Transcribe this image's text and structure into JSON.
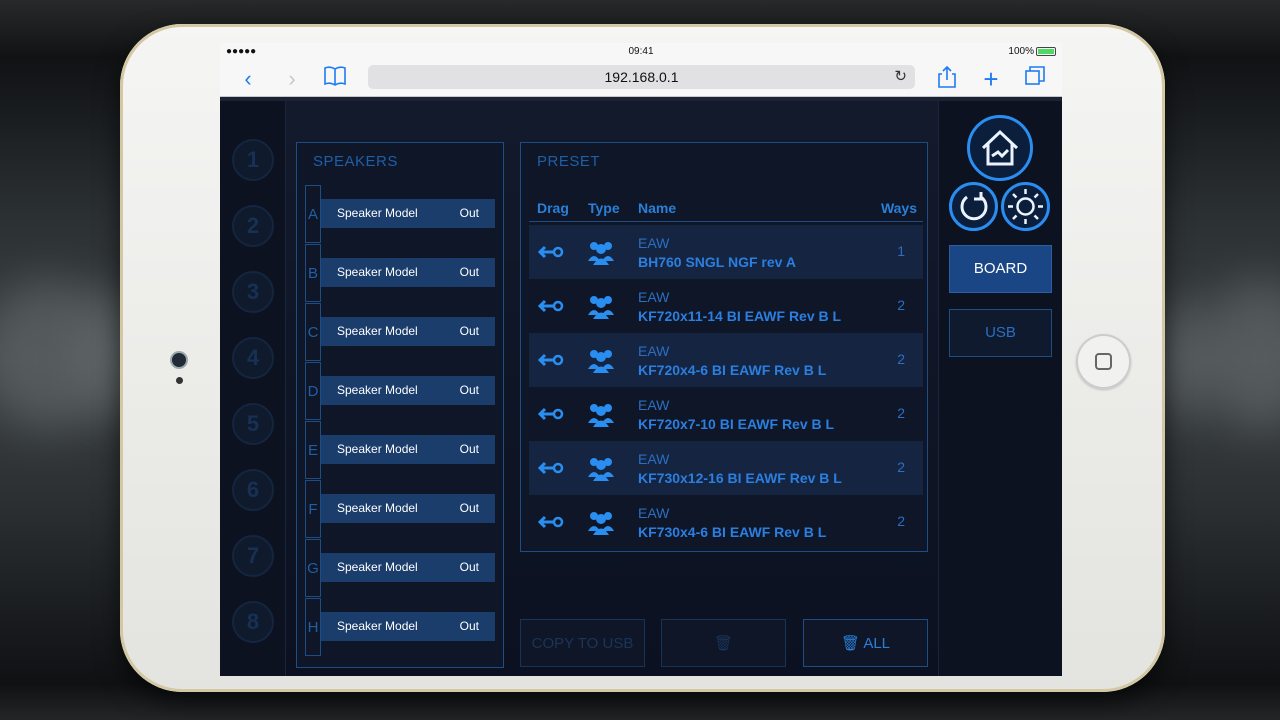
{
  "statusbar": {
    "signal": "●●●●● ",
    "time": "09:41",
    "battery": "100%"
  },
  "browser": {
    "url": "192.168.0.1"
  },
  "rail": [
    "1",
    "2",
    "3",
    "4",
    "5",
    "6",
    "7",
    "8"
  ],
  "speakers": {
    "title": "SPEAKERS",
    "rows": [
      {
        "letter": "A",
        "model": "Speaker Model",
        "out": "Out"
      },
      {
        "letter": "B",
        "model": "Speaker Model",
        "out": "Out"
      },
      {
        "letter": "C",
        "model": "Speaker Model",
        "out": "Out"
      },
      {
        "letter": "D",
        "model": "Speaker Model",
        "out": "Out"
      },
      {
        "letter": "E",
        "model": "Speaker Model",
        "out": "Out"
      },
      {
        "letter": "F",
        "model": "Speaker Model",
        "out": "Out"
      },
      {
        "letter": "G",
        "model": "Speaker Model",
        "out": "Out"
      },
      {
        "letter": "H",
        "model": "Speaker Model",
        "out": "Out"
      }
    ]
  },
  "preset": {
    "title": "PRESET",
    "headers": {
      "drag": "Drag",
      "type": "Type",
      "name": "Name",
      "ways": "Ways"
    },
    "rows": [
      {
        "brand": "EAW",
        "name": "BH760 SNGL NGF rev A",
        "ways": "1"
      },
      {
        "brand": "EAW",
        "name": "KF720x11-14 BI EAWF Rev B L",
        "ways": "2"
      },
      {
        "brand": "EAW",
        "name": "KF720x4-6 BI EAWF Rev B L",
        "ways": "2"
      },
      {
        "brand": "EAW",
        "name": "KF720x7-10 BI EAWF Rev B L",
        "ways": "2"
      },
      {
        "brand": "EAW",
        "name": "KF730x12-16 BI EAWF Rev B L",
        "ways": "2"
      },
      {
        "brand": "EAW",
        "name": "KF730x4-6 BI EAWF Rev B L",
        "ways": "2"
      }
    ]
  },
  "actions": {
    "copy_to_usb": "COPY TO USB",
    "delete": "🗑",
    "delete_all": "🗑 ALL"
  },
  "side": {
    "board": "BOARD",
    "usb": "USB"
  },
  "colors": {
    "accent": "#2a8ef0",
    "panel_border": "#1e4d86",
    "button_bg": "#1b3d6b"
  }
}
